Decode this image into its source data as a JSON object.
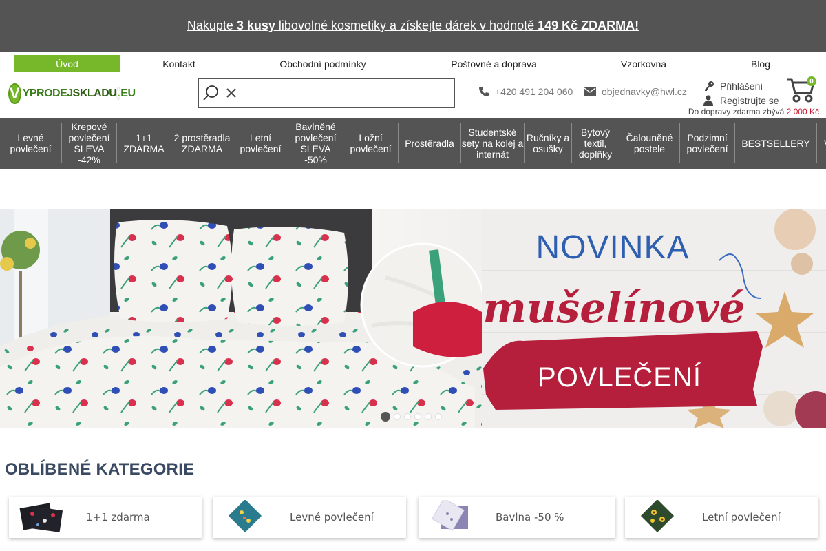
{
  "promo": {
    "t1": "Nakupte ",
    "t2": "3 kusy",
    "t3": " libovolné kosmetiky a získejte dárek v hodnotě ",
    "t4": "149 Kč ZDARMA!"
  },
  "top_nav": [
    "Úvod",
    "Kontakt",
    "Obchodní podmínky",
    "Poštovné a doprava",
    "Vzorkovna",
    "Blog"
  ],
  "logo": {
    "badge": "V",
    "word1": "YPRODEJ",
    "word2": "SKLADU",
    "dot": ".",
    "tld": "EU"
  },
  "search": {
    "placeholder": "",
    "value": ""
  },
  "contact": {
    "phone": "+420 491 204 060",
    "email": "objednavky@hwl.cz"
  },
  "account": {
    "login": "Přihlášení",
    "register": "Registrujte se"
  },
  "cart": {
    "count": "0"
  },
  "free_shipping": {
    "label": "Do dopravy zdarma zbývá ",
    "amount": "2 000 Kč"
  },
  "categories_nav": [
    "Levné povlečení",
    "Krepové povlečení SLEVA -42%",
    "1+1 ZDARMA",
    "2 prostěradla ZDARMA",
    "Letní povlečení",
    "Bavlněné povlečení SLEVA -50%",
    "Ložní povlečení",
    "Prostěradla",
    "Studentské sety na kolej a internát",
    "Ručníky a osušky",
    "Bytový textil, doplňky",
    "Čalouněné postele",
    "Podzimní povlečení",
    "BESTSELLERY",
    "V"
  ],
  "hero": {
    "line1": "NOVINKA",
    "line2": "mušelínové",
    "line3": "POVLEČENÍ",
    "slide_count": 6,
    "active_slide": 1,
    "colors": {
      "blue": "#2f5fb0",
      "red": "#b51f3c"
    }
  },
  "favorites": {
    "title": "OBLÍBENÉ KATEGORIE",
    "tiles": [
      "1+1 zdarma",
      "Levné povlečení",
      "Bavlna -50 %",
      "Letní povlečení"
    ]
  },
  "colors": {
    "accent": "#76b82a",
    "bar": "#545454",
    "price_red": "#c9152b"
  }
}
